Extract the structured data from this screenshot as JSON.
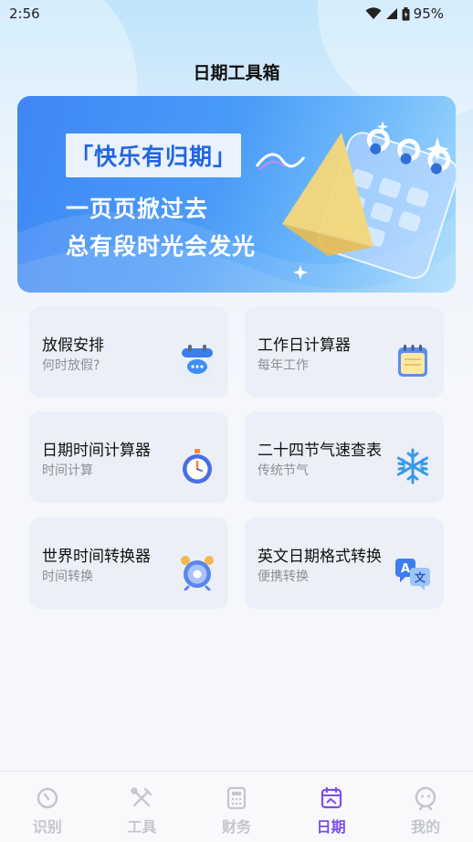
{
  "status_bar": {
    "time": "2:56",
    "battery": "95%"
  },
  "page": {
    "title": "日期工具箱"
  },
  "banner": {
    "tag": "「快乐有归期」",
    "line1": "一页页掀过去",
    "line2": "总有段时光会发光"
  },
  "tools": [
    {
      "title": "放假安排",
      "subtitle": "何时放假?",
      "icon": "calendar-chat-icon"
    },
    {
      "title": "工作日计算器",
      "subtitle": "每年工作",
      "icon": "notepad-calendar-icon"
    },
    {
      "title": "日期时间计算器",
      "subtitle": "时间计算",
      "icon": "stopwatch-icon"
    },
    {
      "title": "二十四节气速查表",
      "subtitle": "传统节气",
      "icon": "snowflake-icon"
    },
    {
      "title": "世界时间转换器",
      "subtitle": "时间转换",
      "icon": "alarm-clock-icon"
    },
    {
      "title": "英文日期格式转换",
      "subtitle": "便携转换",
      "icon": "translate-icon"
    }
  ],
  "tabbar": {
    "items": [
      {
        "label": "识别",
        "icon": "scan-icon"
      },
      {
        "label": "工具",
        "icon": "tools-icon"
      },
      {
        "label": "财务",
        "icon": "calculator-icon"
      },
      {
        "label": "日期",
        "icon": "calendar-icon",
        "active": true
      },
      {
        "label": "我的",
        "icon": "profile-icon"
      }
    ],
    "active_color": "#7b4ee8",
    "inactive_color": "#c3c6cc"
  }
}
